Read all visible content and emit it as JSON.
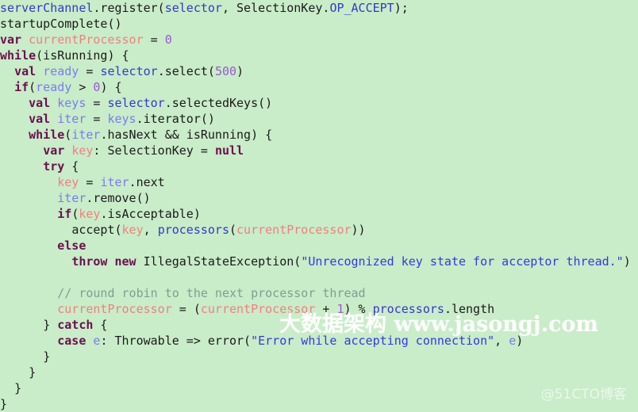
{
  "editor": {
    "language": "scala",
    "background_color": "#c9ecc9",
    "default_text_color": "#1a1a1a",
    "font_size_px": 15,
    "line_height_px": 20,
    "total_lines": 23,
    "palette": {
      "keyword": "#6a0f4e",
      "identifier": "#3737c8",
      "local_value": "#7b7bf0",
      "mutable_variable": "#f08080",
      "number": "#9b59d0",
      "string": "#3737e0",
      "comment": "#7f9f8f",
      "plain": "#1a1a1a"
    }
  },
  "code": {
    "lines": [
      "serverChannel.register(selector, SelectionKey.OP_ACCEPT);",
      "startupComplete()",
      "var currentProcessor = 0",
      "while(isRunning) {",
      "  val ready = selector.select(500)",
      "  if(ready > 0) {",
      "    val keys = selector.selectedKeys()",
      "    val iter = keys.iterator()",
      "    while(iter.hasNext && isRunning) {",
      "      var key: SelectionKey = null",
      "      try {",
      "        key = iter.next",
      "        iter.remove()",
      "        if(key.isAcceptable)",
      "          accept(key, processors(currentProcessor))",
      "        else",
      "          throw new IllegalStateException(\"Unrecognized key state for acceptor thread.\")",
      "",
      "        // round robin to the next processor thread",
      "        currentProcessor = (currentProcessor + 1) % processors.length",
      "      } catch {",
      "        case e: Throwable => error(\"Error while accepting connection\", e)",
      "      }",
      "    }",
      "  }",
      "}"
    ],
    "line_01": {
      "t1": "serverChannel",
      "t2": ".register(",
      "t3": "selector",
      "t4": ", SelectionKey.",
      "t5": "OP_ACCEPT",
      "t6": ");"
    },
    "line_02": {
      "t1": "startupComplete()"
    },
    "line_03": {
      "t1": "var",
      "t2": " ",
      "t3": "currentProcessor",
      "t4": " = ",
      "t5": "0"
    },
    "line_04": {
      "t1": "while",
      "t2": "(isRunning) {"
    },
    "line_05": {
      "indent": "  ",
      "t1": "val",
      "t2": " ",
      "t3": "ready",
      "t4": " = ",
      "t5": "selector",
      "t6": ".select(",
      "t7": "500",
      "t8": ")"
    },
    "line_06": {
      "indent": "  ",
      "t1": "if",
      "t2": "(",
      "t3": "ready",
      "t4": " > ",
      "t5": "0",
      "t6": ") {"
    },
    "line_07": {
      "indent": "    ",
      "t1": "val",
      "t2": " ",
      "t3": "keys",
      "t4": " = ",
      "t5": "selector",
      "t6": ".selectedKeys()"
    },
    "line_08": {
      "indent": "    ",
      "t1": "val",
      "t2": " ",
      "t3": "iter",
      "t4": " = ",
      "t5": "keys",
      "t6": ".iterator()"
    },
    "line_09": {
      "indent": "    ",
      "t1": "while",
      "t2": "(",
      "t3": "iter",
      "t4": ".hasNext && isRunning) {"
    },
    "line_10": {
      "indent": "      ",
      "t1": "var",
      "t2": " ",
      "t3": "key",
      "t4": ": SelectionKey = ",
      "t5": "null"
    },
    "line_11": {
      "indent": "      ",
      "t1": "try",
      "t2": " {"
    },
    "line_12": {
      "indent": "        ",
      "t1": "key",
      "t2": " = ",
      "t3": "iter",
      "t4": ".next"
    },
    "line_13": {
      "indent": "        ",
      "t1": "iter",
      "t2": ".remove()"
    },
    "line_14": {
      "indent": "        ",
      "t1": "if",
      "t2": "(",
      "t3": "key",
      "t4": ".isAcceptable)"
    },
    "line_15": {
      "indent": "          ",
      "t1": "accept(",
      "t2": "key",
      "t3": ", ",
      "t4": "processors",
      "t5": "(",
      "t6": "currentProcessor",
      "t7": "))"
    },
    "line_16": {
      "indent": "        ",
      "t1": "else"
    },
    "line_17": {
      "indent": "          ",
      "t1": "throw",
      "t2": " ",
      "t3": "new",
      "t4": " IllegalStateException(",
      "t5": "\"Unrecognized key state for acceptor thread.\"",
      "t6": ")"
    },
    "line_18": {
      "t1": ""
    },
    "line_19": {
      "indent": "        ",
      "t1": "// round robin to the next processor thread"
    },
    "line_20": {
      "indent": "        ",
      "t1": "currentProcessor",
      "t2": " = (",
      "t3": "currentProcessor",
      "t4": " + ",
      "t5": "1",
      "t6": ") % ",
      "t7": "processors",
      "t8": ".length"
    },
    "line_21": {
      "indent": "      ",
      "t1": "} ",
      "t2": "catch",
      "t3": " {"
    },
    "line_22": {
      "indent": "        ",
      "t1": "case",
      "t2": " ",
      "t3": "e",
      "t4": ": Throwable => error(",
      "t5": "\"Error while accepting connection\"",
      "t6": ", ",
      "t7": "e",
      "t8": ")"
    },
    "line_23": {
      "indent": "      ",
      "t1": "}"
    },
    "line_24": {
      "indent": "    ",
      "t1": "}"
    },
    "line_25": {
      "indent": "  ",
      "t1": "}"
    },
    "line_26": {
      "t1": "}"
    }
  },
  "watermarks": {
    "center": "大数据架构 www.jasongj.com",
    "corner": "@51CTO博客"
  }
}
